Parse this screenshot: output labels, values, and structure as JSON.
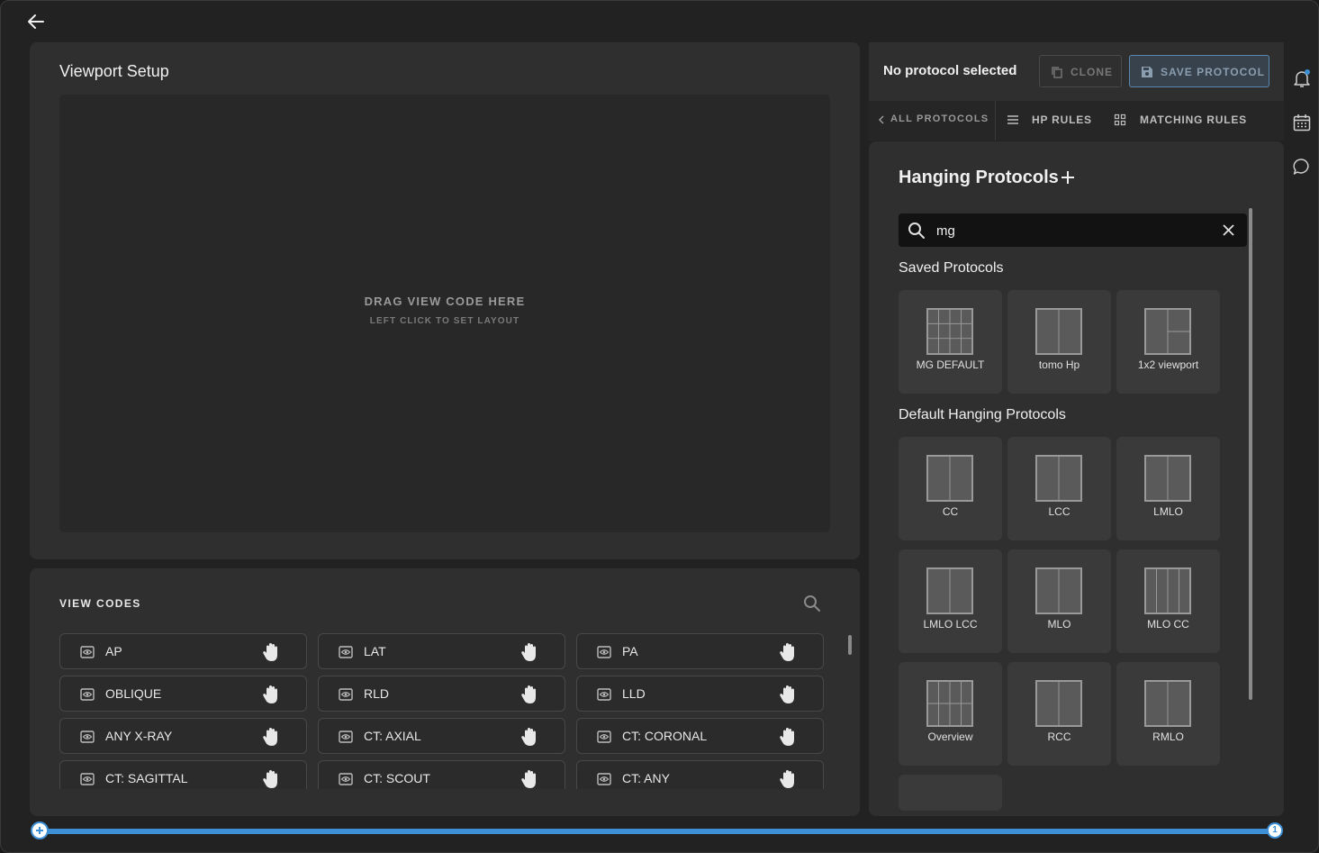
{
  "viewport": {
    "title": "Viewport Setup",
    "drop_title": "DRAG VIEW CODE HERE",
    "drop_subtitle": "LEFT CLICK TO SET LAYOUT"
  },
  "view_codes": {
    "title": "VIEW CODES",
    "items": [
      {
        "label": "AP"
      },
      {
        "label": "LAT"
      },
      {
        "label": "PA"
      },
      {
        "label": "OBLIQUE"
      },
      {
        "label": "RLD"
      },
      {
        "label": "LLD"
      },
      {
        "label": "ANY X-RAY"
      },
      {
        "label": "CT: AXIAL"
      },
      {
        "label": "CT: CORONAL"
      },
      {
        "label": "CT: SAGITTAL"
      },
      {
        "label": "CT: SCOUT"
      },
      {
        "label": "CT: ANY"
      }
    ]
  },
  "header": {
    "status": "No protocol selected",
    "clone_label": "CLONE",
    "save_label": "SAVE PROTOCOL"
  },
  "tabs": {
    "all_protocols": "ALL PROTOCOLS",
    "hp_rules": "HP RULES",
    "matching_rules": "MATCHING RULES"
  },
  "hanging_protocols": {
    "title": "Hanging Protocols",
    "search_value": "mg",
    "saved_label": "Saved Protocols",
    "saved": [
      {
        "name": "MG DEFAULT",
        "grid": "3x3"
      },
      {
        "name": "tomo Hp",
        "grid": "1x2"
      },
      {
        "name": "1x2 viewport",
        "grid": "1x2-split"
      }
    ],
    "default_label": "Default Hanging Protocols",
    "defaults": [
      {
        "name": "CC",
        "grid": "1x2"
      },
      {
        "name": "LCC",
        "grid": "1x2"
      },
      {
        "name": "LMLO",
        "grid": "1x2"
      },
      {
        "name": "LMLO LCC",
        "grid": "1x2"
      },
      {
        "name": "MLO",
        "grid": "1x2"
      },
      {
        "name": "MLO CC",
        "grid": "1x4"
      },
      {
        "name": "Overview",
        "grid": "4x2"
      },
      {
        "name": "RCC",
        "grid": "1x2"
      },
      {
        "name": "RMLO",
        "grid": "1x2"
      }
    ]
  },
  "slider": {
    "end_value": "1"
  },
  "colors": {
    "accent": "#3d8fd6",
    "notification_dot": "#3d8fd6",
    "panel": "#2f2f2f",
    "card": "#3a3a3a"
  },
  "icons": [
    "back-arrow-icon",
    "search-icon",
    "eye-icon",
    "hand-icon",
    "copy-icon",
    "save-icon",
    "chevron-left-icon",
    "list-icon",
    "grid-icon",
    "plus-icon",
    "close-icon",
    "bell-icon",
    "calendar-icon",
    "chat-icon"
  ]
}
